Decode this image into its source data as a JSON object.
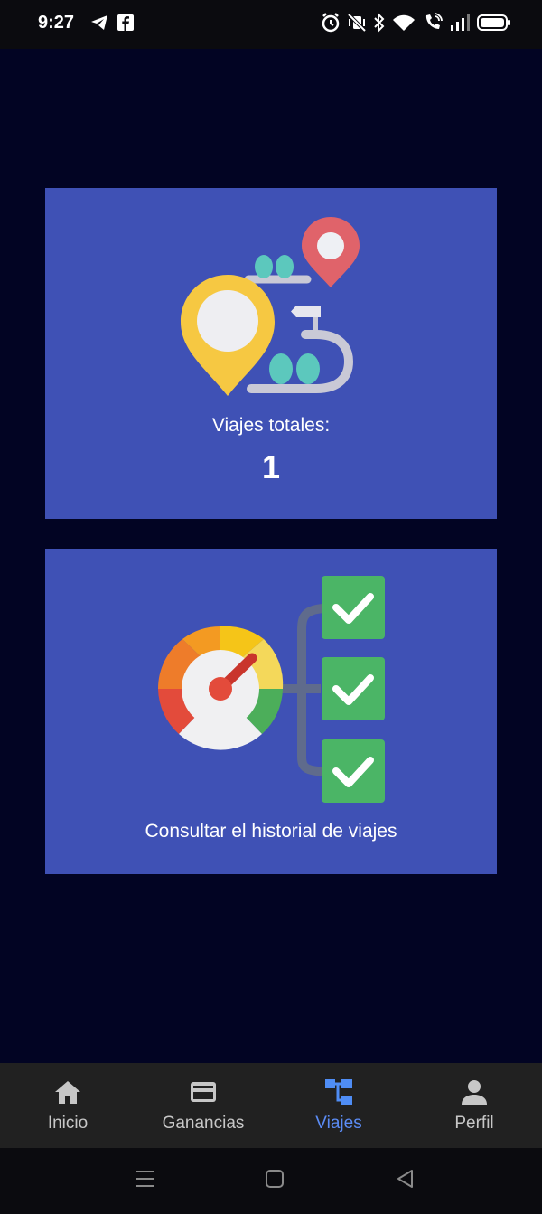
{
  "status_bar": {
    "time": "9:27",
    "left_icons": [
      "telegram-icon",
      "facebook-icon"
    ],
    "right_icons": [
      "alarm-icon",
      "vibrate-off-icon",
      "bluetooth-icon",
      "wifi-icon",
      "wifi-call-icon",
      "signal-icon",
      "battery-icon"
    ]
  },
  "cards": {
    "trips_total": {
      "label": "Viajes totales:",
      "value": "1",
      "icon": "route-map-icon"
    },
    "history": {
      "label": "Consultar el historial de viajes",
      "icon": "speedometer-checklist-icon"
    }
  },
  "bottom_nav": {
    "items": [
      {
        "label": "Inicio",
        "icon": "home-icon",
        "active": false
      },
      {
        "label": "Ganancias",
        "icon": "card-icon",
        "active": false
      },
      {
        "label": "Viajes",
        "icon": "trips-icon",
        "active": true
      },
      {
        "label": "Perfil",
        "icon": "person-icon",
        "active": false
      }
    ]
  },
  "colors": {
    "background": "#020423",
    "card": "#3f51b5",
    "nav_bar": "#212121",
    "active": "#5b8cf5"
  }
}
